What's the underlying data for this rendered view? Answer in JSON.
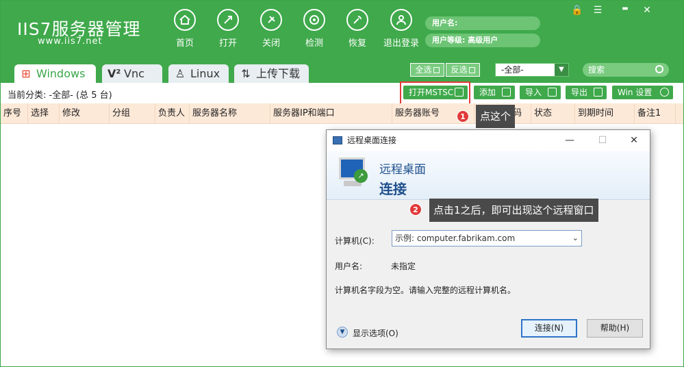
{
  "app": {
    "logo": "IIS7服务器管理",
    "logo_url": "www.iis7.net",
    "nav": [
      {
        "label": "首页",
        "icon": "home-icon"
      },
      {
        "label": "打开",
        "icon": "open-icon"
      },
      {
        "label": "关闭",
        "icon": "close-icon"
      },
      {
        "label": "检测",
        "icon": "detect-icon"
      },
      {
        "label": "恢复",
        "icon": "restore-icon"
      },
      {
        "label": "退出登录",
        "icon": "logout-icon"
      }
    ],
    "user": {
      "name_label": "用户名:",
      "level_label": "用户等级:",
      "level_value": "高级用户"
    },
    "window_controls": {
      "lock": "🔒",
      "menu": "☰",
      "minimize": "▬",
      "close": "✕"
    }
  },
  "tabs": [
    {
      "label": "Windows",
      "active": true
    },
    {
      "label": "Vnc",
      "active": false
    },
    {
      "label": "Linux",
      "active": false
    },
    {
      "label": "上传下载",
      "active": false
    }
  ],
  "header_actions": {
    "select_all": "全选",
    "invert": "反选",
    "filter_value": "-全部-",
    "search_placeholder": "搜索"
  },
  "toolbar": {
    "current_category": "当前分类:  -全部- (总 5 台)",
    "buttons": [
      "打开MSTSC",
      "添加",
      "导入",
      "导出",
      "Win 设置"
    ]
  },
  "table": {
    "columns": [
      "序号",
      "选择",
      "修改",
      "分组",
      "负责人",
      "服务器名称",
      "服务器IP和端口",
      "服务器账号",
      "服务器密码",
      "状态",
      "到期时间",
      "备注1"
    ]
  },
  "annotations": [
    {
      "number": "1",
      "text": "点这个"
    },
    {
      "number": "2",
      "text": "点击1之后，即可出现这个远程窗口"
    }
  ],
  "dialog": {
    "title": "远程桌面连接",
    "header_line1": "远程桌面",
    "header_line2": "连接",
    "computer_label": "计算机(C):",
    "computer_placeholder": "示例: computer.fabrikam.com",
    "username_label": "用户名:",
    "username_value": "未指定",
    "message": "计算机名字段为空。请输入完整的远程计算机名。",
    "show_options": "显示选项(O)",
    "connect": "连接(N)",
    "help": "帮助(H)",
    "controls": {
      "minimize": "—",
      "maximize": "☐",
      "close": "✕"
    }
  },
  "colors": {
    "brand_green": "#3fa94b",
    "highlight_red": "#e23a3a",
    "table_header": "#fde9d8"
  }
}
